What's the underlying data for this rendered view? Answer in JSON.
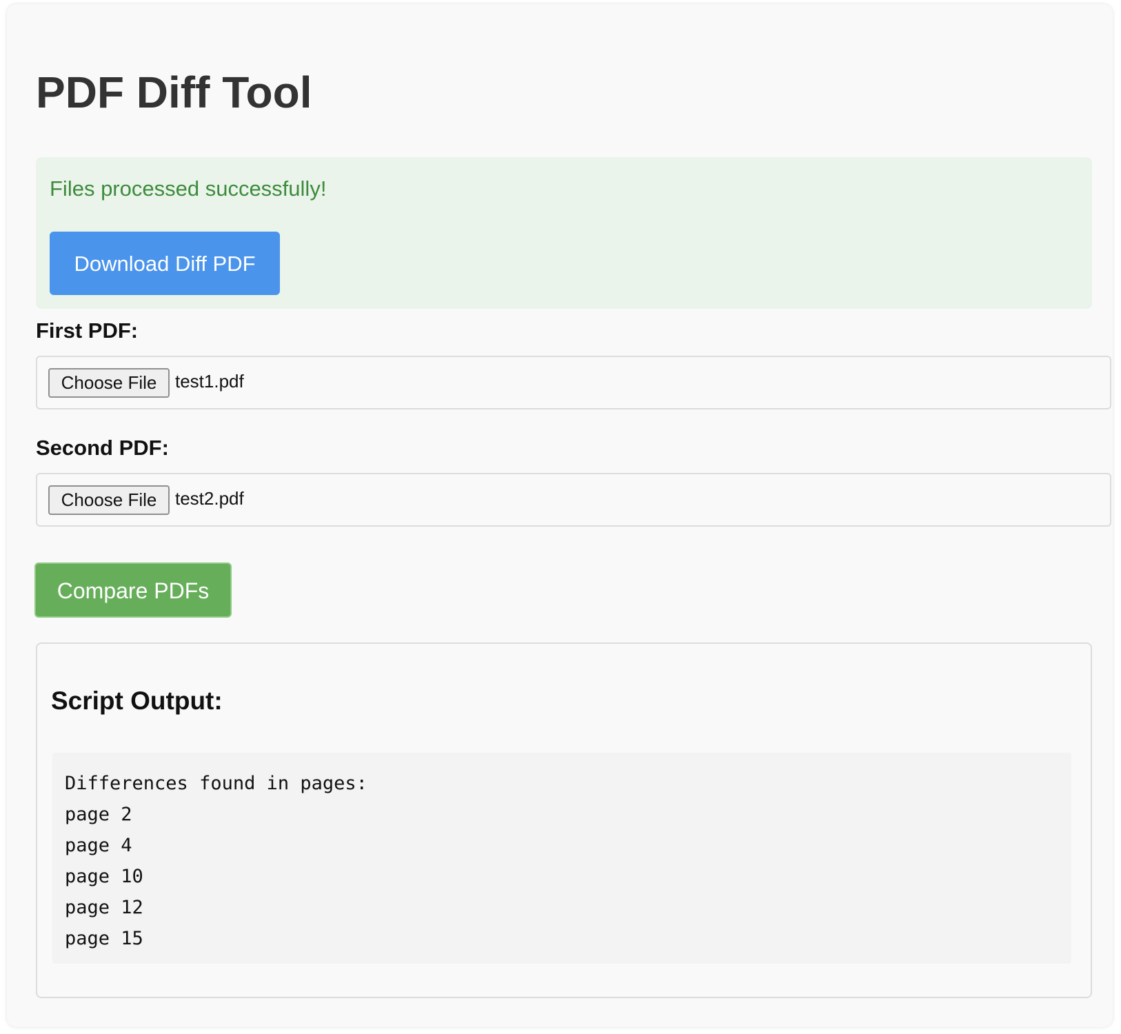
{
  "page": {
    "title": "PDF Diff Tool"
  },
  "success": {
    "message": "Files processed successfully!",
    "download_label": "Download Diff PDF"
  },
  "form": {
    "first": {
      "label": "First PDF:",
      "button_label": "Choose File",
      "file_name": "test1.pdf"
    },
    "second": {
      "label": "Second PDF:",
      "button_label": "Choose File",
      "file_name": "test2.pdf"
    },
    "compare_label": "Compare PDFs"
  },
  "output": {
    "heading": "Script Output:",
    "lines": [
      "Differences found in pages:",
      "page 2",
      "page 4",
      "page 10",
      "page 12",
      "page 15"
    ]
  },
  "colors": {
    "title": "#333333",
    "success_bg": "#eaf4ea",
    "success_text": "#3d8b3d",
    "download_button": "#4a94eb",
    "compare_button": "#67ae5b"
  }
}
